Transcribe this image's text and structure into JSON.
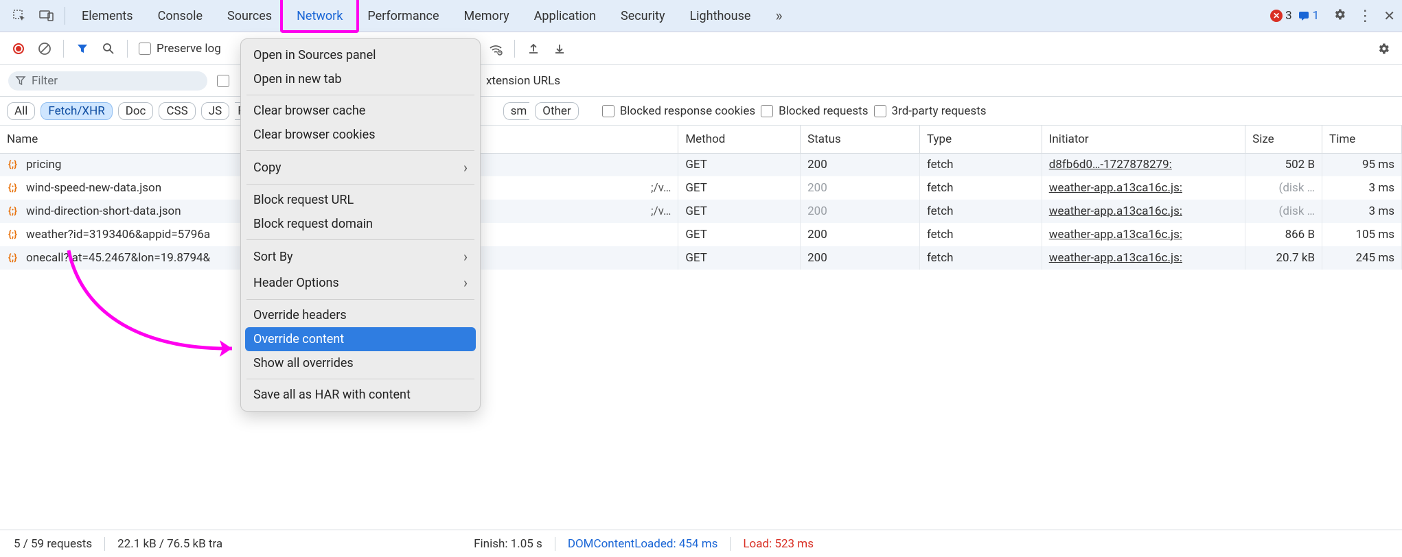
{
  "tabs": {
    "items": [
      "Elements",
      "Console",
      "Sources",
      "Network",
      "Performance",
      "Memory",
      "Application",
      "Security",
      "Lighthouse"
    ],
    "active_index": 3,
    "more_glyph": "»",
    "errors_count": "3",
    "messages_count": "1"
  },
  "toolbar": {
    "preserve_log_label": "Preserve log",
    "hidden_text_fragment": "xtension URLs"
  },
  "filter": {
    "placeholder": "Filter"
  },
  "types": {
    "chips": [
      "All",
      "Fetch/XHR",
      "Doc",
      "CSS",
      "JS"
    ],
    "active_index": 1,
    "partial_chip_text_right": "sm",
    "other_label": "Other",
    "opt_blocked_cookies": "Blocked response cookies",
    "opt_blocked_requests": "Blocked requests",
    "opt_third_party": "3rd-party requests"
  },
  "table": {
    "cols": {
      "name": "Name",
      "method": "Method",
      "status": "Status",
      "type": "Type",
      "initiator": "Initiator",
      "size": "Size",
      "time": "Time"
    },
    "rows": [
      {
        "name": "pricing",
        "path": "",
        "method": "GET",
        "status": "200",
        "status_dim": false,
        "type": "fetch",
        "initiator": "d8fb6d0…-1727878279:",
        "size": "502 B",
        "size_dim": false,
        "time": "95 ms"
      },
      {
        "name": "wind-speed-new-data.json",
        "path": ";/v…",
        "method": "GET",
        "status": "200",
        "status_dim": true,
        "type": "fetch",
        "initiator": "weather-app.a13ca16c.js:",
        "size": "(disk …",
        "size_dim": true,
        "time": "3 ms"
      },
      {
        "name": "wind-direction-short-data.json",
        "path": ";/v…",
        "method": "GET",
        "status": "200",
        "status_dim": true,
        "type": "fetch",
        "initiator": "weather-app.a13ca16c.js:",
        "size": "(disk …",
        "size_dim": true,
        "time": "3 ms"
      },
      {
        "name": "weather?id=3193406&appid=5796a",
        "path": "",
        "method": "GET",
        "status": "200",
        "status_dim": false,
        "type": "fetch",
        "initiator": "weather-app.a13ca16c.js:",
        "size": "866 B",
        "size_dim": false,
        "time": "105 ms"
      },
      {
        "name": "onecall?lat=45.2467&lon=19.8794&",
        "path": "",
        "method": "GET",
        "status": "200",
        "status_dim": false,
        "type": "fetch",
        "initiator": "weather-app.a13ca16c.js:",
        "size": "20.7 kB",
        "size_dim": false,
        "time": "245 ms"
      }
    ]
  },
  "footer": {
    "requests": "5 / 59 requests",
    "transfer": "22.1 kB / 76.5 kB tra",
    "finish": "Finish: 1.05 s",
    "dom": "DOMContentLoaded: 454 ms",
    "load": "Load: 523 ms"
  },
  "context_menu": {
    "items": [
      {
        "label": "Open in Sources panel"
      },
      {
        "label": "Open in new tab"
      },
      {
        "sep": true
      },
      {
        "label": "Clear browser cache"
      },
      {
        "label": "Clear browser cookies"
      },
      {
        "sep": true
      },
      {
        "label": "Copy",
        "submenu": true
      },
      {
        "sep": true
      },
      {
        "label": "Block request URL"
      },
      {
        "label": "Block request domain"
      },
      {
        "sep": true
      },
      {
        "label": "Sort By",
        "submenu": true
      },
      {
        "label": "Header Options",
        "submenu": true
      },
      {
        "sep": true
      },
      {
        "label": "Override headers"
      },
      {
        "label": "Override content",
        "selected": true
      },
      {
        "label": "Show all overrides"
      },
      {
        "sep": true
      },
      {
        "label": "Save all as HAR with content"
      }
    ]
  }
}
